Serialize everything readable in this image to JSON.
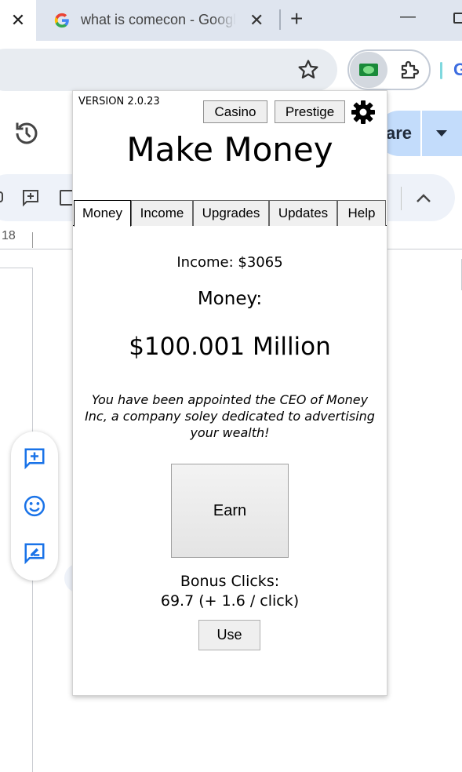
{
  "browser": {
    "prev_tab_close": "✕",
    "tab": {
      "title": "what is comecon - Google Search",
      "close": "✕"
    },
    "new_tab": "+",
    "minimize": "—",
    "extension_icons": [
      "money-bill-icon",
      "puzzle-icon"
    ]
  },
  "docs": {
    "share_label": "are",
    "ruler_number": "18"
  },
  "popup": {
    "version": "VERSION 2.0.23",
    "buttons": {
      "casino": "Casino",
      "prestige": "Prestige",
      "settings_icon": "gear-icon"
    },
    "title": "Make Money",
    "tabs": [
      {
        "label": "Money",
        "active": true
      },
      {
        "label": "Income",
        "active": false
      },
      {
        "label": "Upgrades",
        "active": false
      },
      {
        "label": "Updates",
        "active": false
      },
      {
        "label": "Help",
        "active": false
      }
    ],
    "income_text": "Income: $3065",
    "money_label": "Money:",
    "money_value": "$100.001 Million",
    "description": "You have been appointed the CEO of Money Inc, a company soley dedicated to advertising your wealth!",
    "earn_label": "Earn",
    "bonus_label": "Bonus Clicks:",
    "bonus_value": "69.7 (+ 1.6 / click)",
    "use_label": "Use"
  },
  "colors": {
    "tabstrip_bg": "#dfe5ef",
    "share_button_bg": "#c3dcfb",
    "docs_icon_blue": "#1a73e8",
    "bill_green": "#1a8a3a"
  }
}
